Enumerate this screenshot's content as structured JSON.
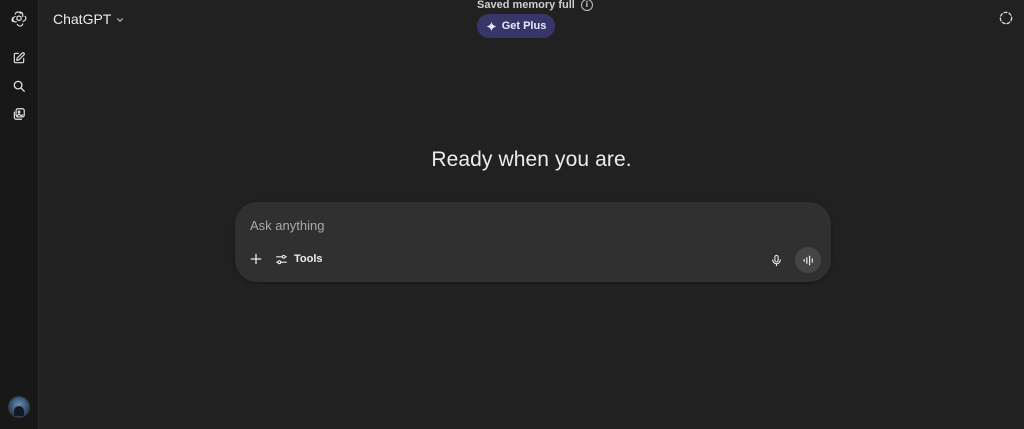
{
  "header": {
    "model_name": "ChatGPT",
    "memory_notice": "Saved memory full",
    "upgrade_label": "Get Plus"
  },
  "main": {
    "headline": "Ready when you are."
  },
  "composer": {
    "placeholder": "Ask anything",
    "value": "",
    "tools_label": "Tools"
  },
  "icons": {
    "logo": "openai-logo-icon",
    "new_chat": "new-chat-icon",
    "search": "search-icon",
    "library": "library-icon",
    "temporary_chat": "temporary-chat-icon",
    "plus": "plus-icon",
    "tools": "sliders-icon",
    "mic": "microphone-icon",
    "voice": "voice-waveform-icon"
  },
  "colors": {
    "background": "#212121",
    "sidebar": "#181818",
    "composer": "#303030",
    "upgrade_button": "#373669",
    "text": "#ececec"
  }
}
